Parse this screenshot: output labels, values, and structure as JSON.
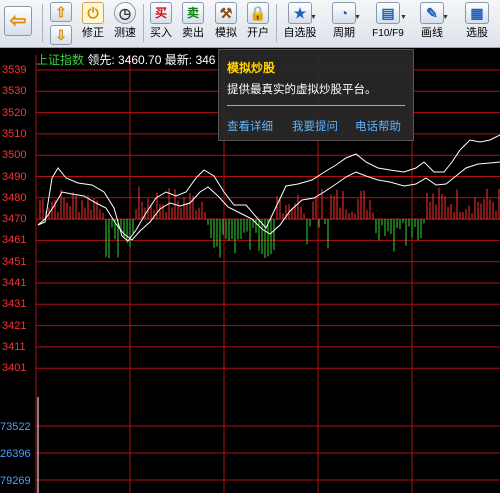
{
  "toolbar": {
    "modify_label": "修正",
    "speed_label": "测速",
    "buy_label": "买入",
    "buy_glyph": "买",
    "sell_label": "卖出",
    "sell_glyph": "卖",
    "simulate_label": "模拟",
    "open_account_label": "开户",
    "watchlist_label": "自选股",
    "period_label": "周期",
    "f10_label": "F10/F9",
    "draw_label": "画线",
    "select_label": "选股"
  },
  "chart": {
    "index_name": "上证指数",
    "leading_label": "领先: ",
    "leading_value": "3460.70",
    "latest_label": " 最新: ",
    "latest_value": "346",
    "y_ticks": [
      "3539",
      "3530",
      "3520",
      "3510",
      "3500",
      "3490",
      "3480",
      "3470",
      "3461",
      "3451",
      "3441",
      "3431",
      "3421",
      "3411",
      "3401"
    ],
    "volume_ticks": [
      "73522",
      "26396",
      "79269"
    ],
    "colors": {
      "up": "#ff3030",
      "down": "#2fdc2f",
      "line": "#ffffff",
      "grid": "#b01010",
      "dash": "#c02020"
    }
  },
  "popup": {
    "title": "模拟炒股",
    "desc": "提供最真实的虚拟炒股平台。",
    "link_detail": "查看详细",
    "link_ask": "我要提问",
    "link_help": "电话帮助"
  }
}
